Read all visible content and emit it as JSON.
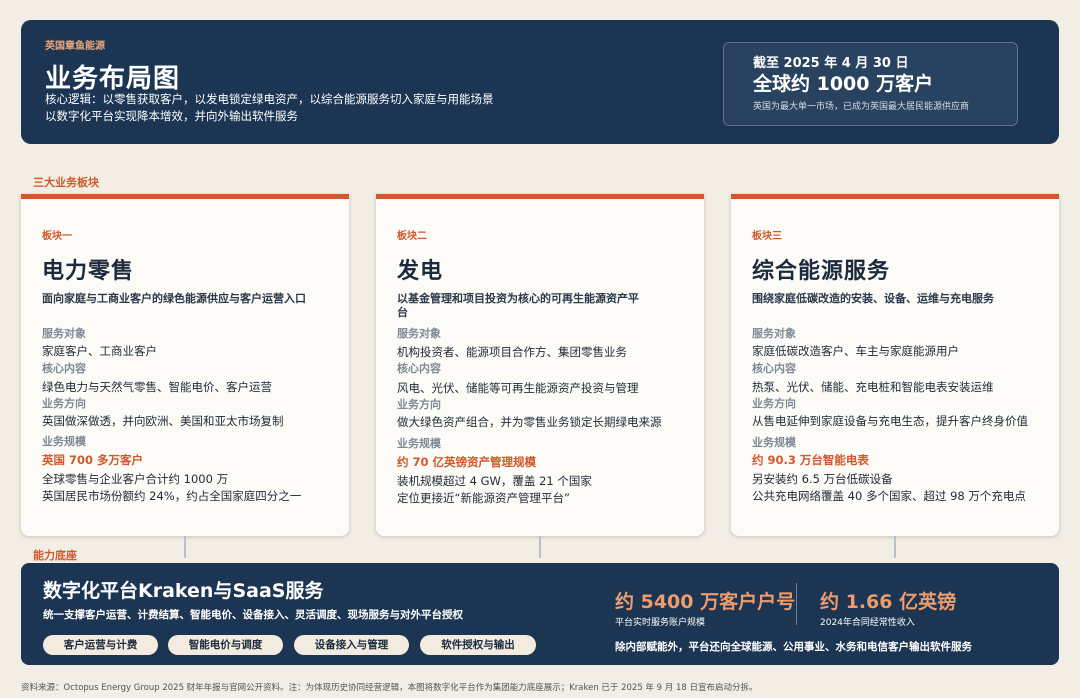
{
  "header": {
    "kicker": "英国章鱼能源",
    "title": "业务布局图",
    "subtitle_line1": "核心逻辑：以零售获取客户，以发电锁定绿电资产，以综合能源服务切入家庭与用能场景",
    "subtitle_line2": "以数字化平台实现降本增效，并向外输出软件服务",
    "stat_date": "截至 2025 年 4 月 30 日",
    "stat_value": "全球约 1000 万客户",
    "stat_note": "英国为最大单一市场，已成为英国最大居民能源供应商"
  },
  "section_segments": "三大业务板块",
  "cards": [
    {
      "tag": "板块一",
      "title": "电力零售",
      "desc": "面向家庭与工商业客户的绿色能源供应与客户运营入口",
      "label_target": "服务对象",
      "target": "家庭客户、工商业客户",
      "label_content": "核心内容",
      "content": "绿色电力与天然气零售、智能电价、客户运营",
      "label_direction": "业务方向",
      "direction": "英国做深做透，并向欧洲、美国和亚太市场复制",
      "label_scale": "业务规模",
      "scale_highlight": "英国 700 多万客户",
      "scale_line1": "全球零售与企业客户合计约 1000 万",
      "scale_line2": "英国居民市场份额约 24%，约占全国家庭四分之一"
    },
    {
      "tag": "板块二",
      "title": "发电",
      "desc": "以基金管理和项目投资为核心的可再生能源资产平台",
      "label_target": "服务对象",
      "target": "机构投资者、能源项目合作方、集团零售业务",
      "label_content": "核心内容",
      "content": "风电、光伏、储能等可再生能源资产投资与管理",
      "label_direction": "业务方向",
      "direction": "做大绿色资产组合，并为零售业务锁定长期绿电来源",
      "label_scale": "业务规模",
      "scale_highlight": "约 70 亿英镑资产管理规模",
      "scale_line1": "装机规模超过 4 GW，覆盖 21 个国家",
      "scale_line2": "定位更接近“新能源资产管理平台”"
    },
    {
      "tag": "板块三",
      "title": "综合能源服务",
      "desc": "围绕家庭低碳改造的安装、设备、运维与充电服务",
      "label_target": "服务对象",
      "target": "家庭低碳改造客户、车主与家庭能源用户",
      "label_content": "核心内容",
      "content": "热泵、光伏、储能、充电桩和智能电表安装运维",
      "label_direction": "业务方向",
      "direction": "从售电延伸到家庭设备与充电生态，提升客户终身价值",
      "label_scale": "业务规模",
      "scale_highlight": "约 90.3 万台智能电表",
      "scale_line1": "另安装约 6.5 万台低碳设备",
      "scale_line2": "公共充电网络覆盖 40 多个国家、超过 98 万个充电点"
    }
  ],
  "section_platform": "能力底座",
  "platform": {
    "title": "数字化平台Kraken与SaaS服务",
    "desc": "统一支撑客户运营、计费结算、智能电价、设备接入、灵活调度、现场服务与对外平台授权",
    "pills": [
      "客户运营与计费",
      "智能电价与调度",
      "设备接入与管理",
      "软件授权与输出"
    ],
    "metric1_value": "约 5400 万客户户号",
    "metric1_note": "平台实时服务账户规模",
    "metric2_value": "约 1.66 亿英镑",
    "metric2_note": "2024年合同经常性收入",
    "footer": "除内部赋能外，平台还向全球能源、公用事业、水务和电信客户输出软件服务"
  },
  "source": "资料来源：Octopus Energy Group 2025 财年年报与官网公开资料。注：为体现历史协同经营逻辑，本图将数字化平台作为集团能力底座展示；Kraken 已于 2025 年 9 月 18 日宣布启动分拆。",
  "colors": {
    "navy": "#1b3553",
    "accent": "#d0582a",
    "metric": "#ee9b6e",
    "background": "#f2ede5"
  }
}
